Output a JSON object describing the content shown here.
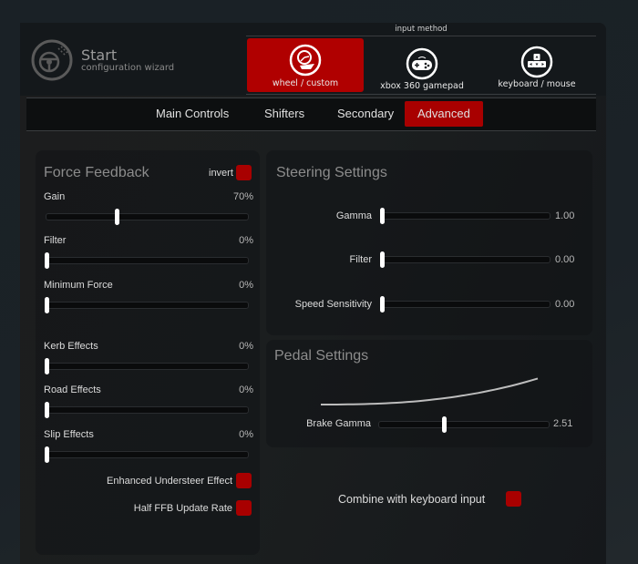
{
  "header": {
    "title": "Start",
    "subtitle": "configuration wizard",
    "input_method_label": "input method",
    "input_methods": [
      {
        "label": "wheel / custom",
        "icon": "steering-wheel-icon",
        "active": true
      },
      {
        "label": "xbox 360 gamepad",
        "icon": "gamepad-icon",
        "active": false
      },
      {
        "label": "keyboard / mouse",
        "icon": "keyboard-arrows-icon",
        "active": false
      }
    ]
  },
  "tabs": [
    {
      "label": "Main Controls",
      "active": false
    },
    {
      "label": "Shifters",
      "active": false
    },
    {
      "label": "Secondary",
      "active": false
    },
    {
      "label": "Advanced",
      "active": true
    }
  ],
  "force_feedback": {
    "title": "Force Feedback",
    "invert_label": "invert",
    "invert_checked": true,
    "sliders": [
      {
        "label": "Gain",
        "value": "70%",
        "fraction": 0.35
      },
      {
        "label": "Filter",
        "value": "0%",
        "fraction": 0.0
      },
      {
        "label": "Minimum Force",
        "value": "0%",
        "fraction": 0.0
      },
      {
        "label": "Kerb Effects",
        "value": "0%",
        "fraction": 0.0
      },
      {
        "label": "Road Effects",
        "value": "0%",
        "fraction": 0.0
      },
      {
        "label": "Slip Effects",
        "value": "0%",
        "fraction": 0.0
      }
    ],
    "checkboxes": [
      {
        "label": "Enhanced Understeer Effect",
        "checked": true
      },
      {
        "label": "Half FFB Update Rate",
        "checked": true
      }
    ]
  },
  "steering": {
    "title": "Steering Settings",
    "sliders": [
      {
        "label": "Gamma",
        "value": "1.00",
        "fraction": 0.0
      },
      {
        "label": "Filter",
        "value": "0.00",
        "fraction": 0.0
      },
      {
        "label": "Speed Sensitivity",
        "value": "0.00",
        "fraction": 0.0
      }
    ]
  },
  "pedal": {
    "title": "Pedal Settings",
    "brake_gamma": {
      "label": "Brake Gamma",
      "value": "2.51",
      "fraction": 0.38
    }
  },
  "combine_keyboard": {
    "label": "Combine with keyboard input",
    "checked": true
  },
  "colors": {
    "accent": "#a80000",
    "background": "#1b2227"
  }
}
